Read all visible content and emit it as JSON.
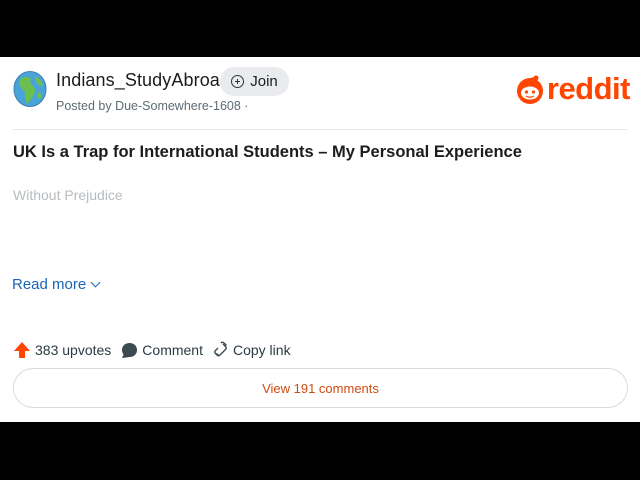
{
  "header": {
    "subreddit": "Indians_StudyAbroad",
    "join_label": "Join",
    "posted_by": "Posted by Due-Somewhere-1608 ·",
    "brand": "reddit",
    "avatar_icon": "globe-icon",
    "brand_icon": "reddit-snoo-icon"
  },
  "post": {
    "title": "UK Is a Trap for International Students – My Personal Experience",
    "body_preview": "Without Prejudice",
    "read_more": "Read more"
  },
  "actions": {
    "upvotes": "383 upvotes",
    "comment": "Comment",
    "copy_link": "Copy link"
  },
  "footer": {
    "view_comments": "View 191 comments"
  },
  "colors": {
    "brand": "#ff4500",
    "link": "#1b64b8",
    "view_comments": "#d14a10"
  }
}
